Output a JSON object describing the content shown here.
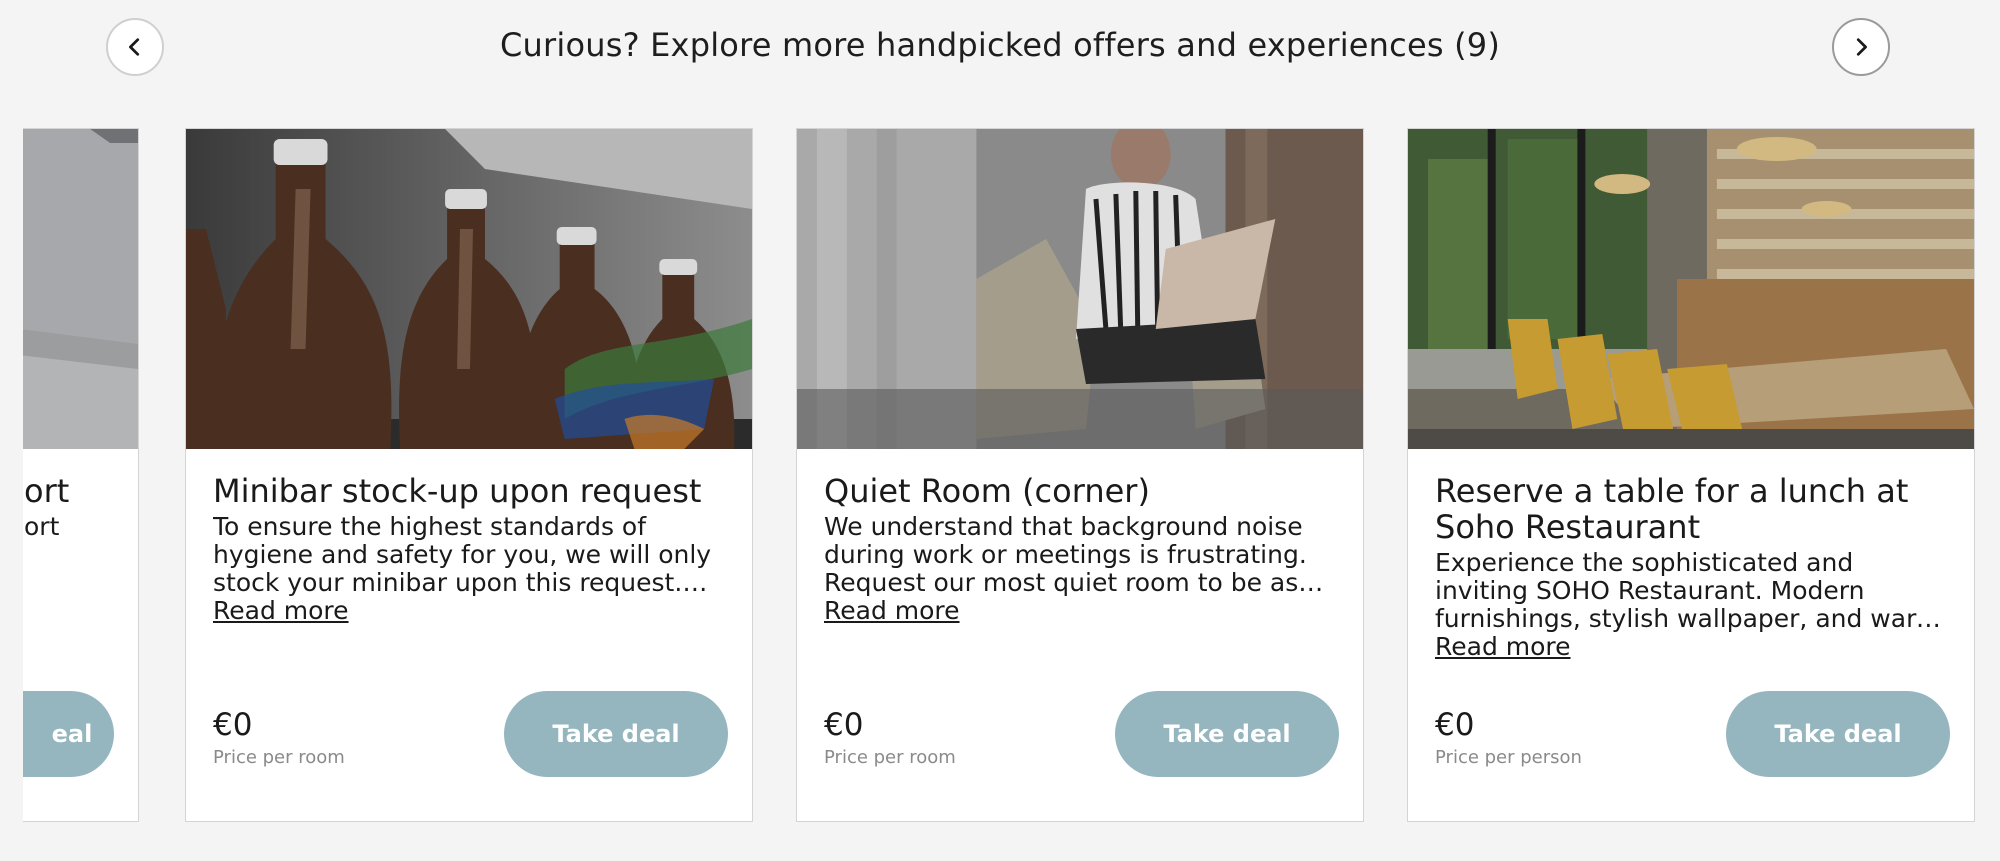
{
  "header": {
    "title": "Curious? Explore more handpicked offers and experiences (9)",
    "prev_icon": "chevron-left-icon",
    "next_icon": "chevron-right-icon"
  },
  "partial_card": {
    "title_fragment": "ort",
    "desc_fragment": "ort",
    "button_fragment": "eal"
  },
  "cards": [
    {
      "title": "Minibar stock-up upon request",
      "description": "To ensure the highest standards of hygiene and safety for you, we will only stock your minibar upon this request. We offer a variety of drinks and snacks for you to enjoy during your stay.",
      "read_more": "Read more",
      "price": "€0",
      "price_note": "Price per room",
      "button": "Take deal"
    },
    {
      "title": "Quiet Room (corner)",
      "description": "We understand that background noise during work or meetings is frustrating. Request our most quiet room to be as productive as possible during your stay.",
      "read_more": "Read more",
      "price": "€0",
      "price_note": "Price per room",
      "button": "Take deal"
    },
    {
      "title": "Reserve a table for a lunch at Soho Restaurant",
      "description": "Experience the sophisticated and inviting SOHO Restaurant. Modern furnishings, stylish wallpaper, and warm lighting create the perfect ambience for your lunch.",
      "read_more": "Read more",
      "price": "€0",
      "price_note": "Price per person",
      "button": "Take deal"
    }
  ]
}
